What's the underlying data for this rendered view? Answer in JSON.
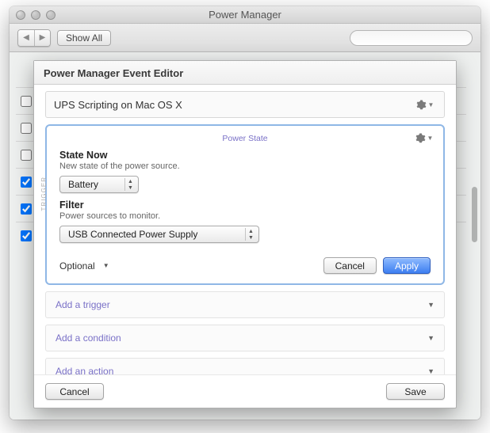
{
  "window": {
    "title": "Power Manager"
  },
  "toolbar": {
    "show_all": "Show All",
    "search_placeholder": ""
  },
  "sheet": {
    "title": "Power Manager Event Editor",
    "event_name": "UPS Scripting on Mac OS X",
    "panel_title": "Power State",
    "side_tab": "TRIGGER",
    "state_now": {
      "label": "State Now",
      "desc": "New state of the power source.",
      "value": "Battery"
    },
    "filter": {
      "label": "Filter",
      "desc": "Power sources to monitor.",
      "value": "USB Connected Power Supply"
    },
    "optional_label": "Optional",
    "cancel": "Cancel",
    "apply": "Apply",
    "add_trigger": "Add a trigger",
    "add_condition": "Add a condition",
    "add_action": "Add an action",
    "footer_cancel": "Cancel",
    "footer_save": "Save"
  }
}
